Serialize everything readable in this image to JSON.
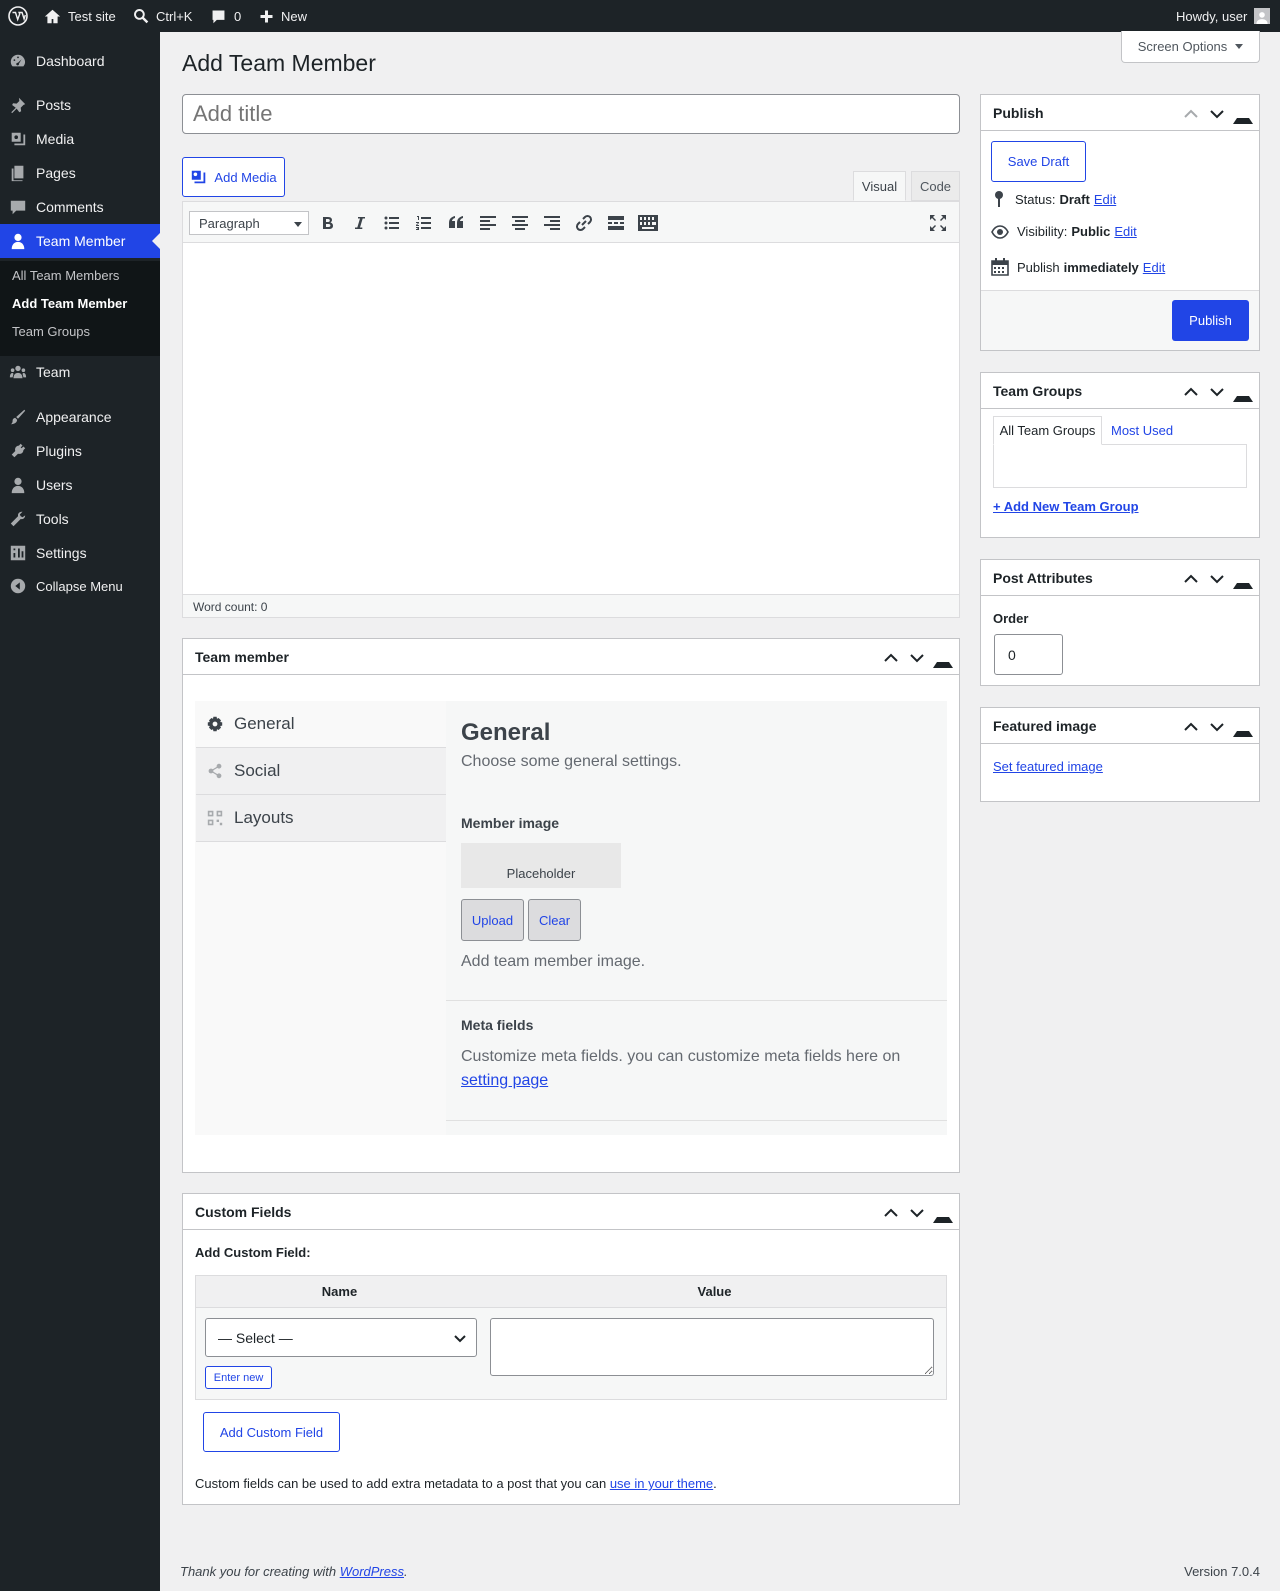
{
  "topbar": {
    "site_name": "Test site",
    "shortcut": "Ctrl+K",
    "comments_count": "0",
    "new_label": "New",
    "greeting": "Howdy, user"
  },
  "sidebar": {
    "items": [
      {
        "label": "Dashboard",
        "icon": "dashboard-icon"
      },
      {
        "label": "Posts",
        "icon": "pin-icon"
      },
      {
        "label": "Media",
        "icon": "media-icon"
      },
      {
        "label": "Pages",
        "icon": "pages-icon"
      },
      {
        "label": "Comments",
        "icon": "comment-icon"
      },
      {
        "label": "Team Member",
        "icon": "person-icon"
      },
      {
        "label": "Team",
        "icon": "groups-icon"
      },
      {
        "label": "Appearance",
        "icon": "brush-icon"
      },
      {
        "label": "Plugins",
        "icon": "plug-icon"
      },
      {
        "label": "Users",
        "icon": "users-icon"
      },
      {
        "label": "Tools",
        "icon": "wrench-icon"
      },
      {
        "label": "Settings",
        "icon": "settings-icon"
      },
      {
        "label": "Collapse Menu",
        "icon": "collapse-icon"
      }
    ],
    "submenu": [
      "All Team Members",
      "Add Team Member",
      "Team Groups"
    ]
  },
  "page": {
    "title": "Add Team Member",
    "screen_options": "Screen Options",
    "title_placeholder": "Add title"
  },
  "editor": {
    "add_media": "Add Media",
    "tab_visual": "Visual",
    "tab_code": "Code",
    "format": "Paragraph",
    "word_count": "Word count: 0"
  },
  "publish": {
    "heading": "Publish",
    "save_draft": "Save Draft",
    "status_label": "Status:",
    "status_value": "Draft",
    "visibility_label": "Visibility:",
    "visibility_value": "Public",
    "publish_label": "Publish",
    "publish_value": "immediately",
    "edit": "Edit",
    "publish_button": "Publish"
  },
  "team_groups": {
    "heading": "Team Groups",
    "tab_all": "All Team Groups",
    "tab_most_used": "Most Used",
    "add_new": "+ Add New Team Group"
  },
  "post_attributes": {
    "heading": "Post Attributes",
    "order_label": "Order",
    "order_value": "0"
  },
  "featured_image": {
    "heading": "Featured image",
    "set_link": "Set featured image"
  },
  "team_member": {
    "heading": "Team member",
    "tabs": [
      {
        "label": "General",
        "icon": "gear-icon"
      },
      {
        "label": "Social",
        "icon": "share-icon"
      },
      {
        "label": "Layouts",
        "icon": "grid-icon"
      }
    ],
    "general_title": "General",
    "general_desc": "Choose some general settings.",
    "member_image_label": "Member image",
    "placeholder": "Placeholder",
    "upload": "Upload",
    "clear": "Clear",
    "image_help": "Add team member image.",
    "meta_fields_label": "Meta fields",
    "meta_fields_desc": "Customize meta fields. you can customize meta fields here on",
    "meta_fields_link": "setting page"
  },
  "custom_fields": {
    "heading": "Custom Fields",
    "add_label": "Add Custom Field:",
    "col_name": "Name",
    "col_value": "Value",
    "select": "— Select —",
    "enter_new": "Enter new",
    "add_button": "Add Custom Field",
    "note_before": "Custom fields can be used to add extra metadata to a post that you can",
    "note_link": "use in your theme",
    "note_after": "."
  },
  "footer": {
    "thanks_before": "Thank you for creating with",
    "thanks_link": "WordPress",
    "thanks_after": ".",
    "version": "Version 7.0.4"
  },
  "colors": {
    "accent": "#2145e6",
    "sidebar": "#1d2327",
    "background": "#f0f0f1"
  }
}
